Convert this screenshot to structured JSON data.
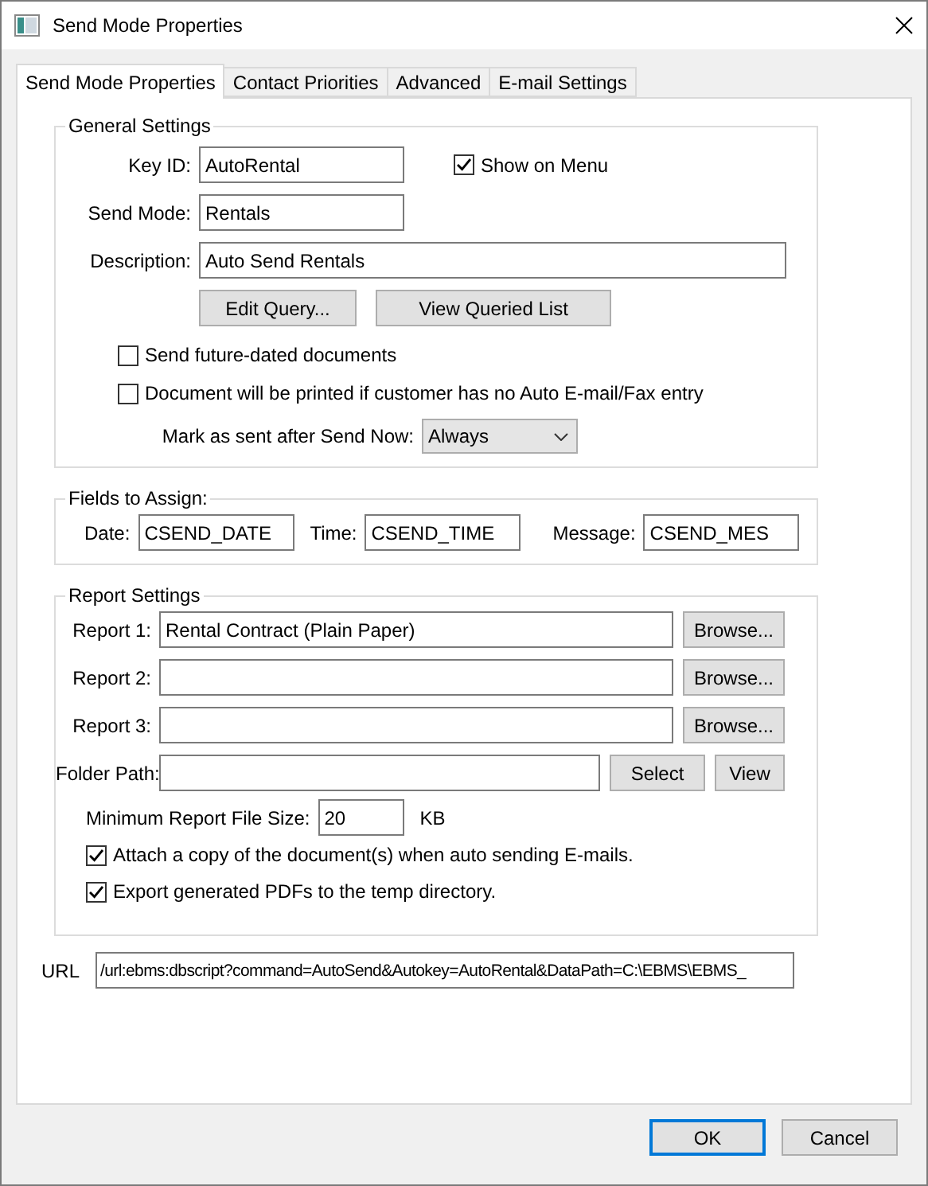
{
  "window": {
    "title": "Send Mode Properties"
  },
  "tabs": [
    {
      "label": "Send Mode Properties",
      "selected": true
    },
    {
      "label": "Contact Priorities",
      "selected": false
    },
    {
      "label": "Advanced",
      "selected": false
    },
    {
      "label": "E-mail Settings",
      "selected": false
    }
  ],
  "general_settings": {
    "title": "General Settings",
    "key_id": {
      "label": "Key ID:",
      "value": "AutoRental"
    },
    "show_on_menu": {
      "label": "Show on Menu",
      "checked": true
    },
    "send_mode": {
      "label": "Send Mode:",
      "value": "Rentals"
    },
    "description": {
      "label": "Description:",
      "value": "Auto Send Rentals"
    },
    "buttons": [
      "Edit Query...",
      "View Queried List"
    ],
    "options": [
      {
        "label": "Send future-dated documents",
        "checked": false
      },
      {
        "label": "Document will be printed if customer has no Auto E-mail/Fax entry",
        "checked": false
      }
    ],
    "mark_as_sent": {
      "label": "Mark as sent after Send Now:",
      "value": "Always"
    }
  },
  "fields_to_assign": {
    "title": "Fields to Assign:",
    "fields": [
      {
        "label": "Date:",
        "value": "CSEND_DATE"
      },
      {
        "label": "Time:",
        "value": "CSEND_TIME"
      },
      {
        "label": "Message:",
        "value": "CSEND_MES"
      }
    ]
  },
  "report_settings": {
    "title": "Report Settings",
    "reports": [
      {
        "label": "Report 1:",
        "value": "Rental Contract (Plain Paper)",
        "button": "Browse..."
      },
      {
        "label": "Report 2:",
        "button": "Browse..."
      },
      {
        "label": "Report 3:",
        "button": "Browse..."
      }
    ],
    "folder_path": {
      "label": "Folder Path:",
      "buttons": [
        "Select",
        "View"
      ]
    },
    "min_size": {
      "label": "Minimum Report File Size:",
      "value": "20",
      "unit": "KB"
    },
    "options": [
      {
        "label": "Attach a copy of the document(s) when auto sending E-mails.",
        "checked": true
      },
      {
        "label": "Export generated PDFs to the temp directory.",
        "checked": true
      }
    ]
  },
  "url": {
    "label": "URL",
    "value": "/url:ebms:dbscript?command=AutoSend&Autokey=AutoRental&DataPath=C:\\EBMS\\EBMS_"
  },
  "buttons": [
    {
      "label": "OK",
      "default": true
    },
    {
      "label": "Cancel",
      "default": false
    }
  ]
}
